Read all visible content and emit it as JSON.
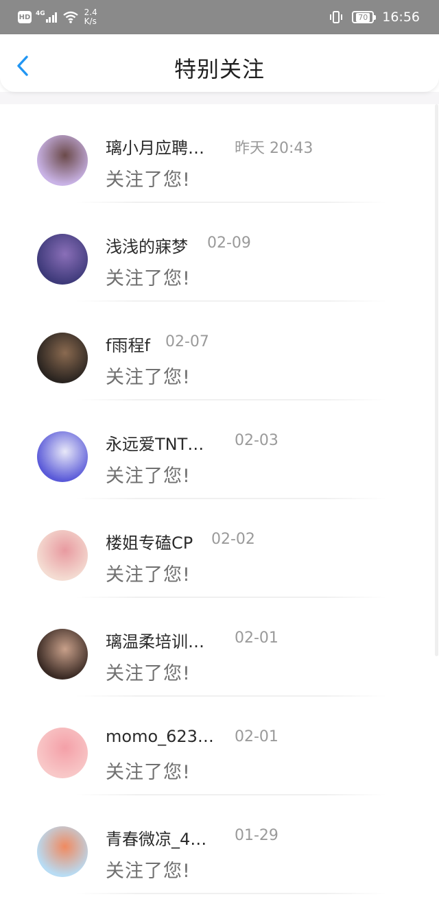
{
  "status_bar": {
    "hd": "HD",
    "network": "4G",
    "speed_value": "2.4",
    "speed_unit": "K/s",
    "battery": "70",
    "time": "16:56"
  },
  "header": {
    "title": "特别关注",
    "back_icon": "chevron-left-icon"
  },
  "colors": {
    "accent": "#2196f3",
    "status_bar": "#8a8a8a",
    "text_primary": "#2b2b2b",
    "text_secondary": "#9a9a9a"
  },
  "items": [
    {
      "name": "璃小月应聘…",
      "time": "昨天 20:43",
      "message": "关注了您!",
      "avatar_colors": [
        "#c9b3e6",
        "#6b4a4a"
      ]
    },
    {
      "name": "浅浅的寐梦",
      "time": "02-09",
      "message": "关注了您!",
      "avatar_colors": [
        "#3e3a7a",
        "#8a6fb8"
      ]
    },
    {
      "name": "f雨程f",
      "time": "02-07",
      "message": "关注了您!",
      "avatar_colors": [
        "#2a2420",
        "#8a6a50"
      ]
    },
    {
      "name": "永远爱TNT…",
      "time": "02-03",
      "message": "关注了您!",
      "avatar_colors": [
        "#5a5ad8",
        "#e8e8f8"
      ]
    },
    {
      "name": "楼姐专磕CP",
      "time": "02-02",
      "message": "关注了您!",
      "avatar_colors": [
        "#f4dcd2",
        "#e89aa0"
      ]
    },
    {
      "name": "璃温柔培训…",
      "time": "02-01",
      "message": "关注了您!",
      "avatar_colors": [
        "#3a2a24",
        "#c8a08a"
      ]
    },
    {
      "name": "momo_623…",
      "time": "02-01",
      "message": "关注了您!",
      "avatar_colors": [
        "#f8c8c8",
        "#f4a0a8"
      ]
    },
    {
      "name": "青春微凉_4…",
      "time": "01-29",
      "message": "关注了您!",
      "avatar_colors": [
        "#b8dcf4",
        "#f08a60"
      ]
    }
  ]
}
